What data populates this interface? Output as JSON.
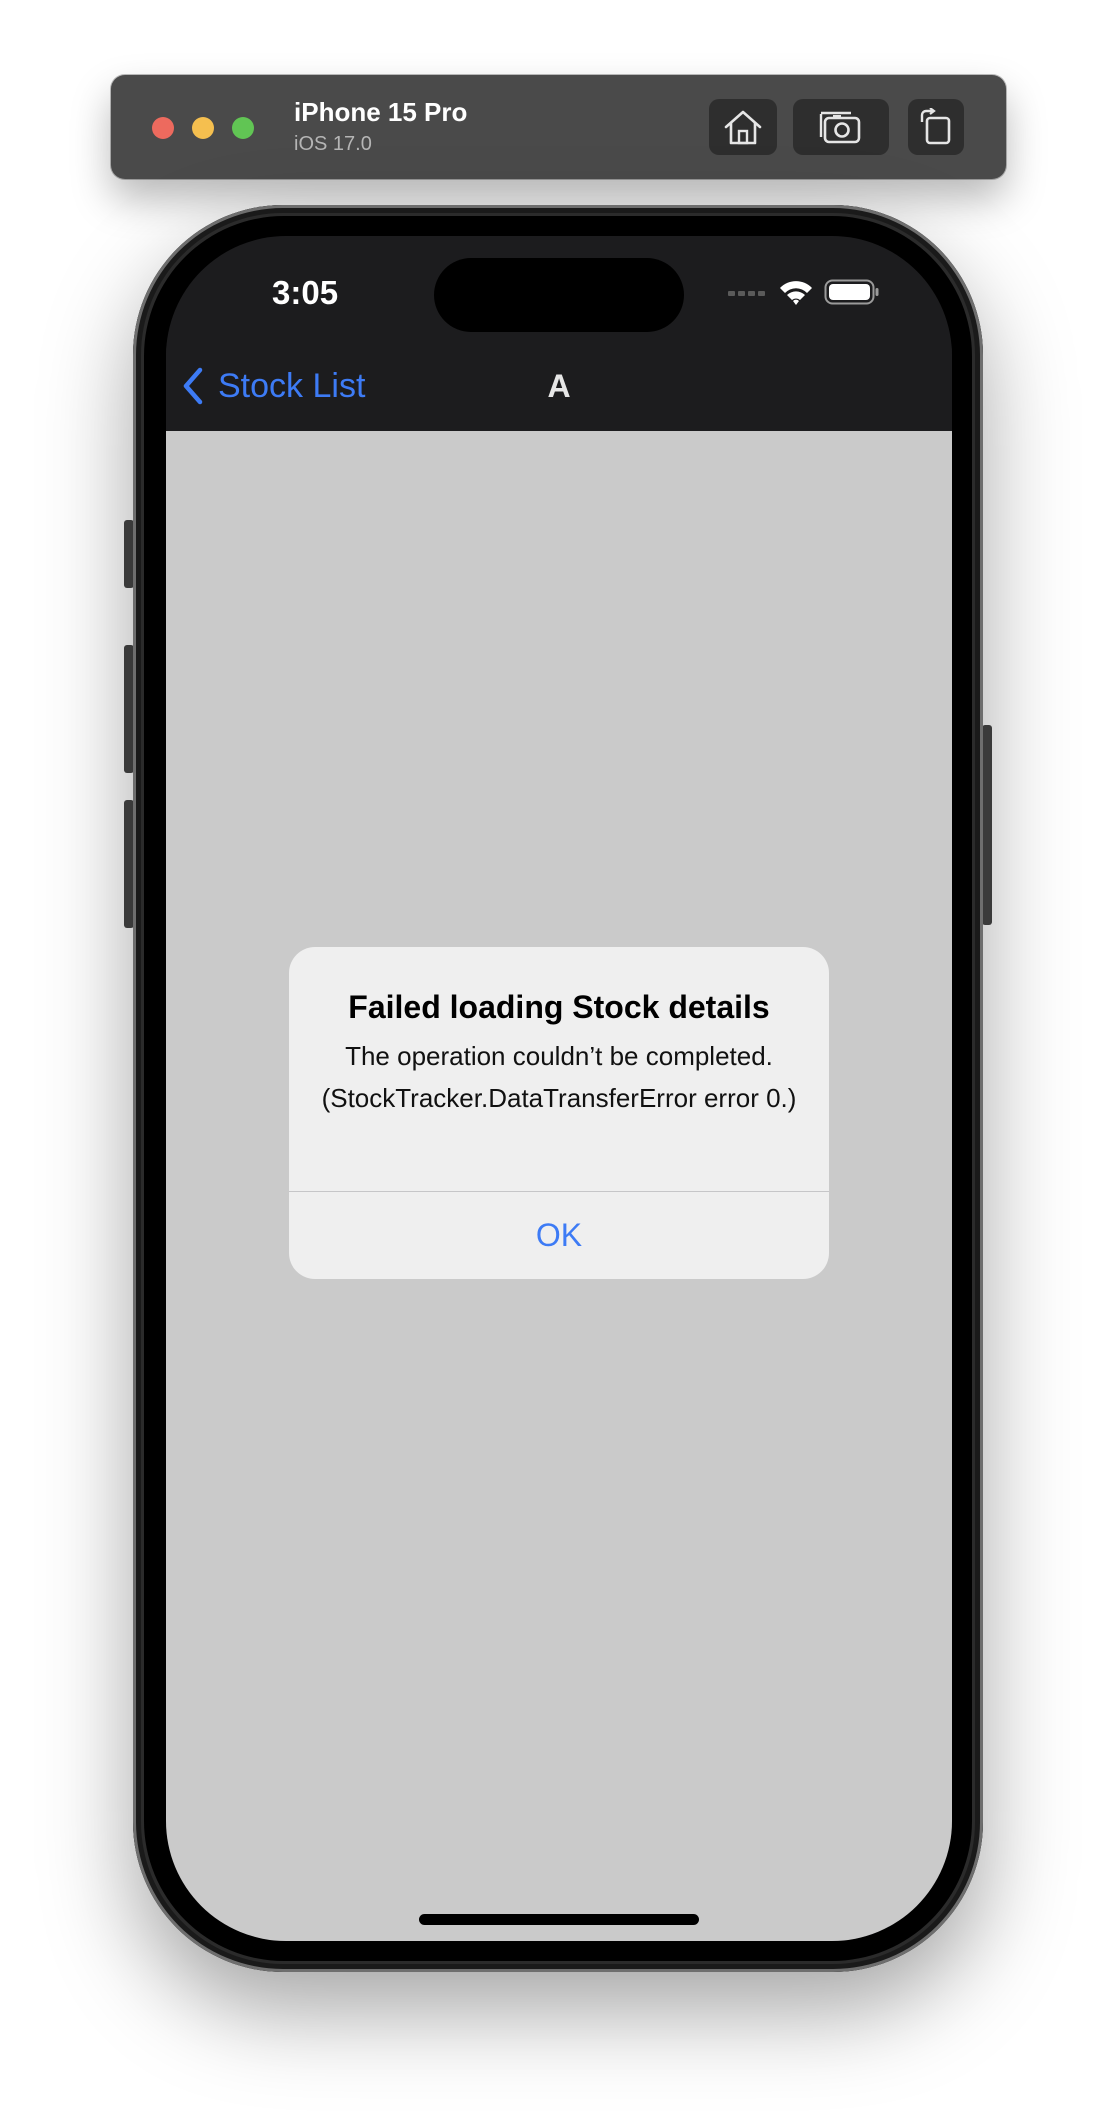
{
  "simulator": {
    "device_name": "iPhone 15 Pro",
    "os_version": "iOS 17.0",
    "buttons": [
      "home-icon",
      "screenshot-icon",
      "rotate-icon"
    ]
  },
  "status_bar": {
    "time": "3:05"
  },
  "nav_bar": {
    "back_label": "Stock List",
    "title": "A"
  },
  "alert": {
    "title": "Failed loading Stock details",
    "message": "The operation couldn’t be completed. (StockTracker.DataTransferError error 0.)",
    "ok_label": "OK"
  },
  "colors": {
    "accent": "#3d7bf5",
    "nav_background": "#1c1c1e",
    "content_background": "#cacaca",
    "alert_background": "#efefef"
  }
}
